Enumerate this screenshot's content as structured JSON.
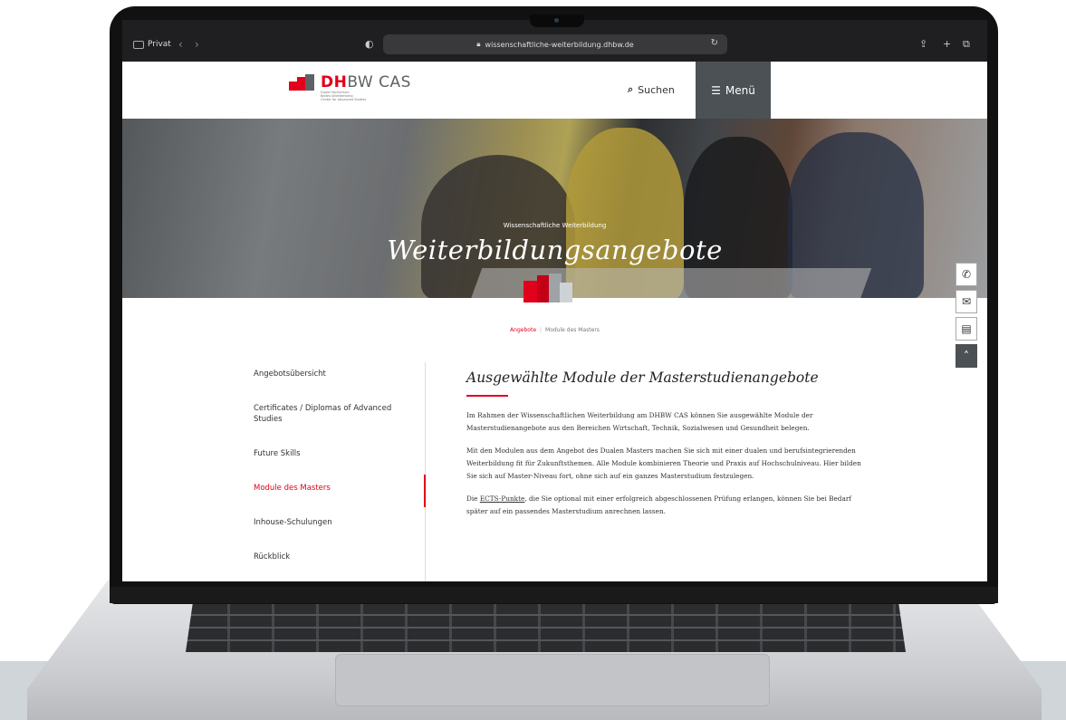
{
  "browser": {
    "tab_label": "Privat",
    "url": "wissenschaftliche-weiterbildung.dhbw.de"
  },
  "site": {
    "logo": {
      "dh": "DH",
      "bw": "BW",
      "cas": "CAS",
      "sub1": "Duale Hochschule",
      "sub2": "Baden-Württemberg",
      "sub3": "Center for Advanced Studies"
    },
    "search_label": "Suchen",
    "menu_label": "Menü"
  },
  "hero": {
    "kicker": "Wissenschaftliche Weiterbildung",
    "title": "Weiterbildungsangebote"
  },
  "breadcrumb": {
    "items": [
      "Angebote",
      "Module des Masters"
    ]
  },
  "sidebar": {
    "items": [
      {
        "label": "Angebotsübersicht",
        "active": false
      },
      {
        "label": "Certificates / Diplomas of Advanced Studies",
        "active": false
      },
      {
        "label": "Future Skills",
        "active": false
      },
      {
        "label": "Module des Masters",
        "active": true
      },
      {
        "label": "Inhouse-Schulungen",
        "active": false
      },
      {
        "label": "Rückblick",
        "active": false
      }
    ]
  },
  "content": {
    "heading": "Ausgewählte Module der Masterstudienangebote",
    "p1": "Im Rahmen der Wissenschaftlichen Weiterbildung am DHBW CAS können Sie ausgewählte Module der Masterstudienangebote aus den Bereichen Wirtschaft, Technik, Sozialwesen und Gesundheit belegen.",
    "p2": "Mit den Modulen aus dem Angebot des Dualen Masters machen Sie sich mit einer dualen und berufsintegrierenden Weiterbildung fit für Zukunftsthemen. Alle Module kombinieren Theorie und Praxis auf Hochschulniveau. Hier bilden Sie sich auf Master-Niveau fort, ohne sich auf ein ganzes Masterstudium festzulegen.",
    "p3_pre": "Die ",
    "p3_link": "ECTS-Punkte",
    "p3_post": ", die Sie optional mit einer erfolgreich abgeschlossenen Prüfung erlangen, können Sie bei Bedarf später auf ein passendes Masterstudium anrechnen lassen."
  },
  "colors": {
    "accent": "#e2001a",
    "dark": "#4b5154"
  },
  "icons": [
    "phone-icon",
    "mail-icon",
    "brochure-icon",
    "chevron-up-icon",
    "search-icon",
    "hamburger-icon",
    "lock-icon",
    "reload-icon",
    "share-icon",
    "plus-icon",
    "tabs-icon"
  ]
}
